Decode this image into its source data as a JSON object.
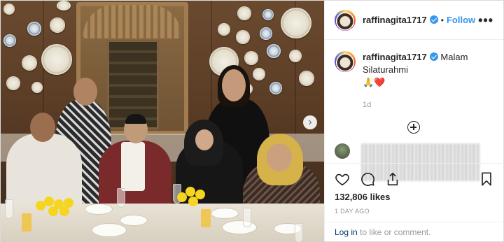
{
  "post": {
    "username": "raffinagita1717",
    "follow_label": "Follow",
    "separator": "•",
    "more_label": "•••",
    "caption_text": "Malam Silaturahmi",
    "caption_emoji": "🙏❤️",
    "time_short": "1d",
    "likes": "132,806 likes",
    "time_ago": "1 DAY AGO",
    "login_link": "Log in",
    "login_rest": " to like or comment.",
    "next_arrow": "›"
  },
  "icons": {
    "verified": "verified-badge-icon",
    "like": "heart-icon",
    "comment": "comment-bubble-icon",
    "share": "share-icon",
    "save": "bookmark-icon",
    "load_more": "plus-circle-icon"
  },
  "colors": {
    "link": "#3897f0",
    "login_link": "#003569",
    "muted": "#999999",
    "text": "#262626",
    "border": "#efefef",
    "heart_emoji": "#e0245e"
  }
}
